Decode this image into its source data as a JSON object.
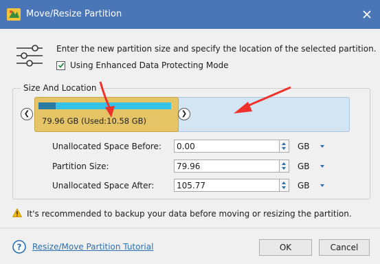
{
  "window": {
    "title": "Move/Resize Partition",
    "accent_color": "#4a76b8",
    "icons": {
      "app": "partition-tool-icon",
      "close": "close-icon"
    }
  },
  "intro": {
    "icon": "sliders-icon",
    "text": "Enter the new partition size and specify the location of the selected partition.",
    "checkbox_label": "Using Enhanced Data Protecting Mode",
    "checkbox_checked": true
  },
  "size_location": {
    "group_label": "Size And Location",
    "partition_label": "79.96 GB (Used:10.58 GB)",
    "used_fraction": 0.132,
    "colors": {
      "partition": "#e5c466",
      "free_space": "#d3e5f3",
      "usage": "#36c1e6",
      "used": "#2a7aa3"
    }
  },
  "fields": [
    {
      "label": "Unallocated Space Before:",
      "value": "0.00",
      "unit": "GB"
    },
    {
      "label": "Partition Size:",
      "value": "79.96",
      "unit": "GB"
    },
    {
      "label": "Unallocated Space After:",
      "value": "105.77",
      "unit": "GB"
    }
  ],
  "warning": {
    "icon": "warning-icon",
    "text": "It's recommended to backup your data before moving or resizing the partition."
  },
  "footer": {
    "help_icon": "help-icon",
    "tutorial_link": "Resize/Move Partition Tutorial",
    "ok_label": "OK",
    "cancel_label": "Cancel"
  },
  "annotations": {
    "arrow_color": "#f0302a"
  }
}
